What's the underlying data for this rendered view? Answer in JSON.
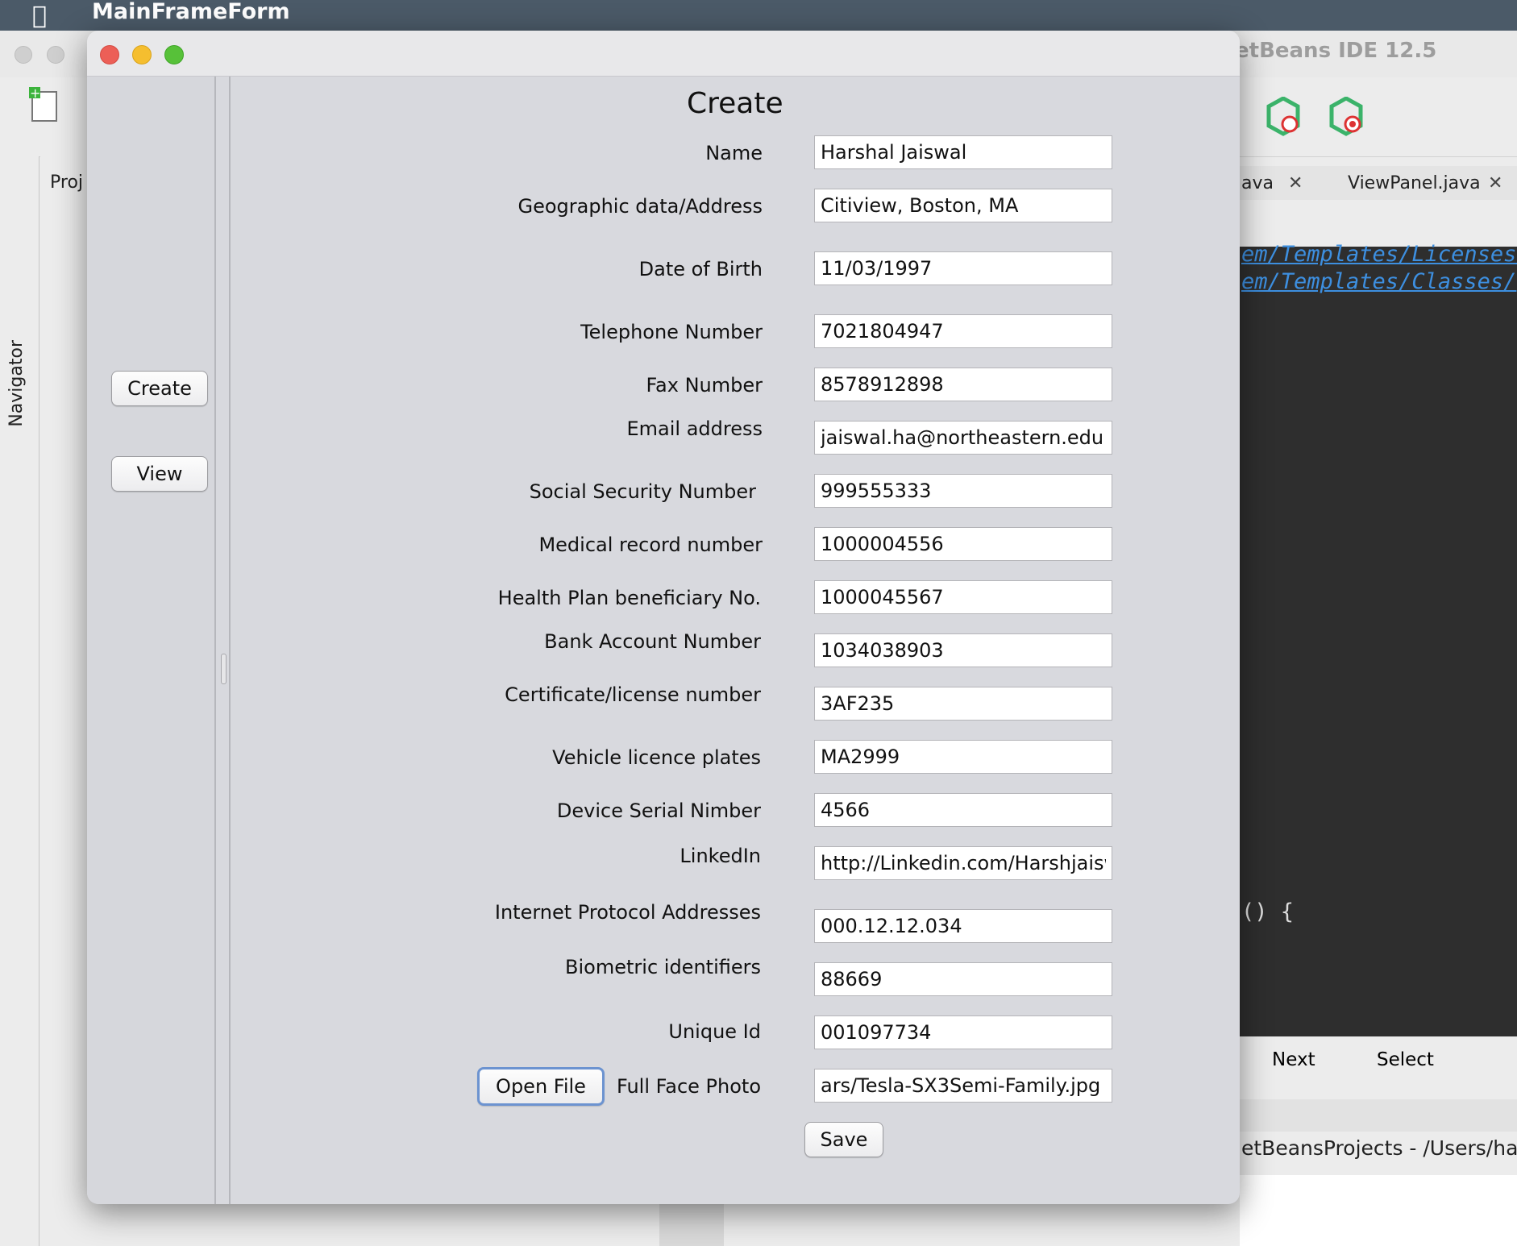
{
  "menubar": {
    "app_name": "MainFrameForm"
  },
  "ide": {
    "title": "etBeans IDE 12.5",
    "navigator_label": "Navigator",
    "projects_label": "Proj",
    "tabs": [
      {
        "label": "ava"
      },
      {
        "label": "ViewPanel.java"
      }
    ],
    "code_lines": [
      "em/Templates/Licenses/",
      "em/Templates/Classes/"
    ],
    "code_snippet": "() {",
    "find_next": "Next",
    "find_select": "Select",
    "output_text": "etBeansProjects - /Users/ha"
  },
  "window": {
    "sidebar": {
      "create_label": "Create",
      "view_label": "View"
    },
    "form": {
      "title": "Create",
      "fields": [
        {
          "label": "Name",
          "value": "Harshal Jaiswal"
        },
        {
          "label": "Geographic data/Address",
          "value": "Citiview, Boston, MA"
        },
        {
          "label": "Date of Birth",
          "value": "11/03/1997"
        },
        {
          "label": "Telephone Number",
          "value": "7021804947"
        },
        {
          "label": "Fax Number",
          "value": "8578912898"
        },
        {
          "label": "Email address",
          "value": "jaiswal.ha@northeastern.edu"
        },
        {
          "label": "Social Security Number",
          "value": "999555333"
        },
        {
          "label": "Medical record number",
          "value": "1000004556"
        },
        {
          "label": "Health Plan beneficiary No.",
          "value": "1000045567"
        },
        {
          "label": "Bank Account Number",
          "value": "1034038903"
        },
        {
          "label": "Certificate/license number",
          "value": "3AF235"
        },
        {
          "label": "Vehicle licence plates",
          "value": "MA2999"
        },
        {
          "label": "Device Serial Nimber",
          "value": "4566"
        },
        {
          "label": "LinkedIn",
          "value": "http://Linkedin.com/Harshjaisw"
        },
        {
          "label": "Internet Protocol Addresses",
          "value": "000.12.12.034"
        },
        {
          "label": "Biometric identifiers",
          "value": "88669"
        },
        {
          "label": "Unique Id",
          "value": "001097734"
        },
        {
          "label": "Full Face Photo",
          "value": "ars/Tesla-SX3Semi-Family.jpg"
        }
      ],
      "open_file_label": "Open File",
      "save_label": "Save"
    }
  }
}
